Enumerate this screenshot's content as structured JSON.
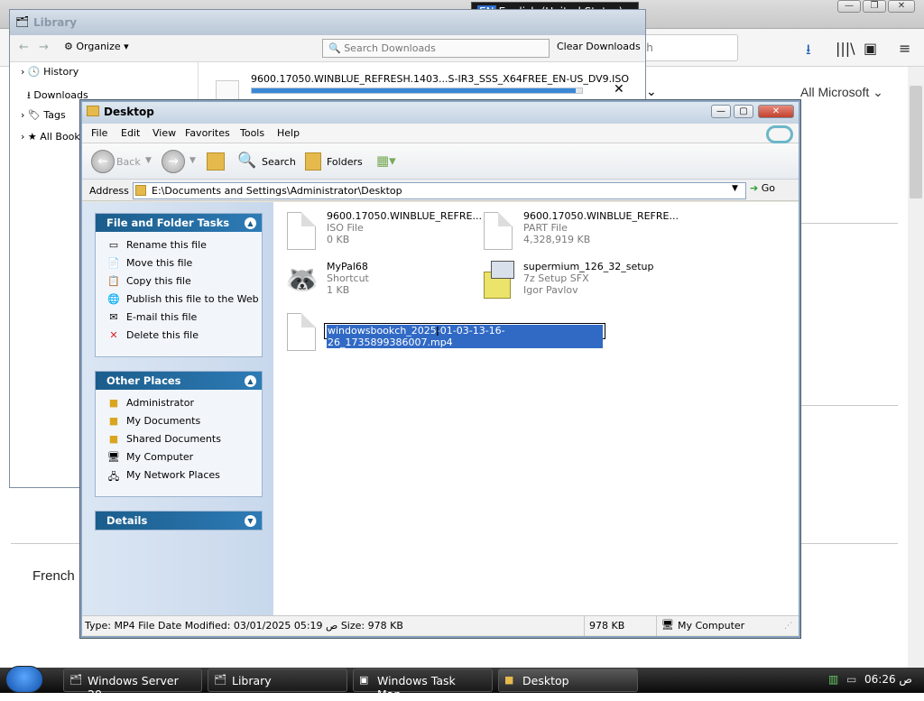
{
  "browser": {
    "search_placeholder": "rch",
    "all_microsoft": "All Microsoft",
    "french": "French"
  },
  "langbar": {
    "code": "EN",
    "label": "English (United States)",
    "help": "?"
  },
  "library": {
    "title": "Library",
    "organize": "Organize",
    "search_placeholder": "Search Downloads",
    "clear_downloads": "Clear Downloads",
    "sidebar": [
      "History",
      "Downloads",
      "Tags",
      "All Book"
    ],
    "download": {
      "name": "9600.17050.WINBLUE_REFRESH.1403...S-IR3_SSS_X64FREE_EN-US_DV9.ISO",
      "progress": 0.98
    }
  },
  "explorer": {
    "title": "Desktop",
    "menu": [
      "File",
      "Edit",
      "View",
      "Favorites",
      "Tools",
      "Help"
    ],
    "toolbar": {
      "back": "Back",
      "search": "Search",
      "folders": "Folders"
    },
    "address_label": "Address",
    "address": "E:\\Documents and Settings\\Administrator\\Desktop",
    "go": "Go",
    "tasks_title": "File and Folder Tasks",
    "tasks": [
      "Rename this file",
      "Move this file",
      "Copy this file",
      "Publish this file to the Web",
      "E-mail this file",
      "Delete this file"
    ],
    "places_title": "Other Places",
    "places": [
      "Administrator",
      "My Documents",
      "Shared Documents",
      "My Computer",
      "My Network Places"
    ],
    "details_title": "Details",
    "files": [
      {
        "name": "9600.17050.WINBLUE_REFRE...",
        "type": "ISO File",
        "size": "0 KB"
      },
      {
        "name": "9600.17050.WINBLUE_REFRE...",
        "type": "PART File",
        "size": "4,328,919 KB"
      },
      {
        "name": "MyPal68",
        "type": "Shortcut",
        "size": "1 KB"
      },
      {
        "name": "supermium_126_32_setup",
        "type": "7z Setup SFX",
        "size": "Igor Pavlov"
      }
    ],
    "rename_value": "windowsbookch_2025-01-03-13-16-26_1735899386007.mp4",
    "status": {
      "info": "Type: MP4 File Date Modified: 03/01/2025 05:19 ص Size: 978 KB",
      "size": "978 KB",
      "zone": "My Computer"
    }
  },
  "taskbar": {
    "tasks": [
      "Windows Server 20...",
      "Library",
      "Windows Task Man...",
      "Desktop"
    ],
    "time": "06:26 ص"
  }
}
